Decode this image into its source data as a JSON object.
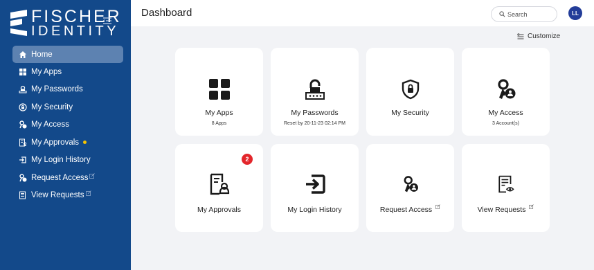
{
  "brand": {
    "line1": "FISCHER",
    "line2": "IDENTITY"
  },
  "sidebar": {
    "items": [
      {
        "label": "Home",
        "icon": "home-icon",
        "active": true
      },
      {
        "label": "My Apps",
        "icon": "apps-grid-icon"
      },
      {
        "label": "My Passwords",
        "icon": "password-lock-icon"
      },
      {
        "label": "My Security",
        "icon": "shield-icon"
      },
      {
        "label": "My Access",
        "icon": "key-user-icon"
      },
      {
        "label": "My Approvals",
        "icon": "approvals-icon",
        "indicator": "notification-dot"
      },
      {
        "label": "My Login History",
        "icon": "login-icon"
      },
      {
        "label": "Request Access",
        "icon": "key-user-icon",
        "external": true
      },
      {
        "label": "View Requests",
        "icon": "list-view-icon",
        "external": true
      }
    ]
  },
  "header": {
    "title": "Dashboard",
    "search_placeholder": "Search",
    "avatar_initials": "LL"
  },
  "toolbar": {
    "customize_label": "Customize"
  },
  "tiles": [
    {
      "label": "My Apps",
      "sub": "8 Apps",
      "icon": "apps-grid-icon"
    },
    {
      "label": "My Passwords",
      "sub": "Reset by 20-11-23 02:14 PM",
      "icon": "password-lock-icon"
    },
    {
      "label": "My Security",
      "sub": "",
      "icon": "shield-icon"
    },
    {
      "label": "My Access",
      "sub": "3 Account(s)",
      "icon": "key-user-icon"
    },
    {
      "label": "My Approvals",
      "badge": "2",
      "icon": "approvals-icon"
    },
    {
      "label": "My Login History",
      "icon": "login-icon"
    },
    {
      "label": "Request Access",
      "icon": "key-user-icon",
      "external": true
    },
    {
      "label": "View Requests",
      "icon": "list-view-icon",
      "external": true
    }
  ],
  "colors": {
    "sidebar_bg": "#13498a",
    "active_item_bg": "#5d82b1",
    "content_bg": "#f2f3f6",
    "badge_red": "#e3262b",
    "indicator_yellow": "#f6c400",
    "avatar_bg": "#233d99"
  }
}
